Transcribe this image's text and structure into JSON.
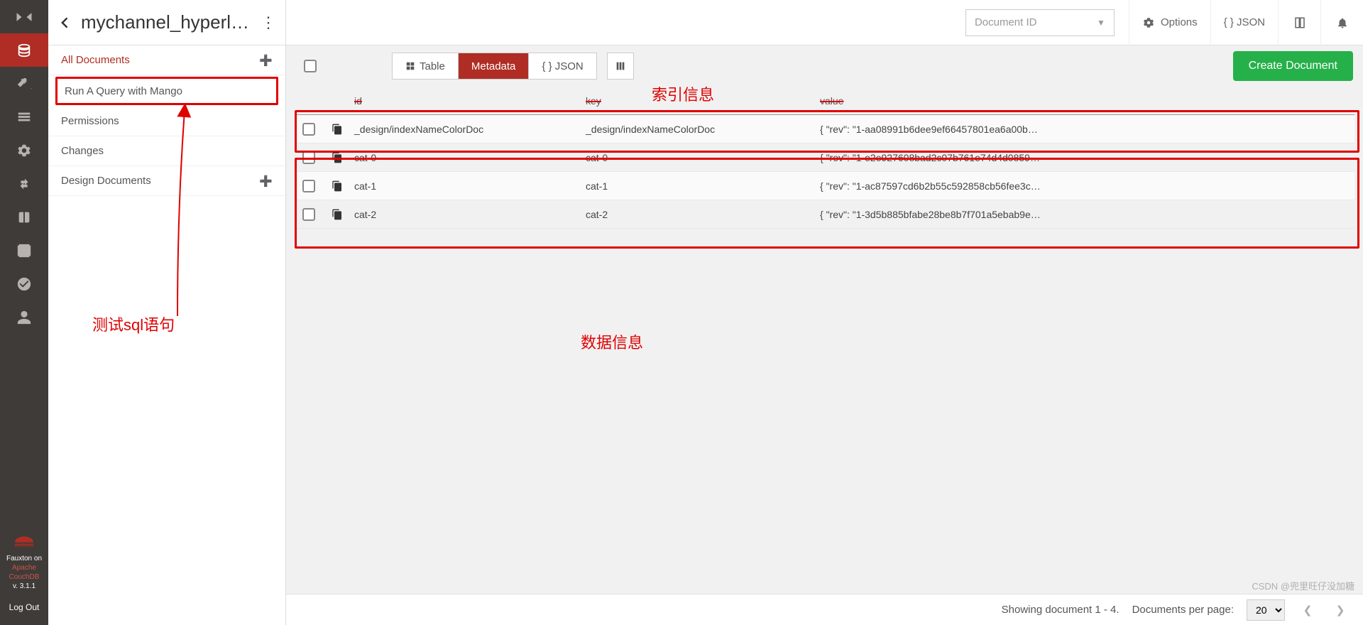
{
  "rail": {
    "fauxton_on": "Fauxton on",
    "apache": "Apache",
    "couchdb": "CouchDB",
    "version": "v. 3.1.1",
    "logout": "Log Out"
  },
  "panel": {
    "db_name": "mychannel_hyperl…",
    "items": {
      "all_documents": "All Documents",
      "run_query": "Run A Query with Mango",
      "permissions": "Permissions",
      "changes": "Changes",
      "design_docs": "Design Documents"
    }
  },
  "topbar": {
    "doc_id_placeholder": "Document ID",
    "options": "Options",
    "json": "{ } JSON"
  },
  "tabs": {
    "table": "Table",
    "metadata": "Metadata",
    "json": "{ } JSON"
  },
  "create_doc": "Create Document",
  "columns": {
    "id": "id",
    "key": "key",
    "value": "value"
  },
  "rows": [
    {
      "id": "_design/indexNameColorDoc",
      "key": "_design/indexNameColorDoc",
      "value": "{ \"rev\": \"1-aa08991b6dee9ef66457801ea6a00b…"
    },
    {
      "id": "cat-0",
      "key": "cat-0",
      "value": "{ \"rev\": \"1-e2e927608bad2c07b761e74d4d0859…"
    },
    {
      "id": "cat-1",
      "key": "cat-1",
      "value": "{ \"rev\": \"1-ac87597cd6b2b55c592858cb56fee3c…"
    },
    {
      "id": "cat-2",
      "key": "cat-2",
      "value": "{ \"rev\": \"1-3d5b885bfabe28be8b7f701a5ebab9e…"
    }
  ],
  "footer": {
    "showing": "Showing document 1 - 4.",
    "per_page_label": "Documents per page:",
    "per_page_value": "20"
  },
  "annotations": {
    "index_info": "索引信息",
    "data_info": "数据信息",
    "sql_test": "测试sql语句"
  },
  "watermark": "CSDN @兜里旺仔没加糖"
}
